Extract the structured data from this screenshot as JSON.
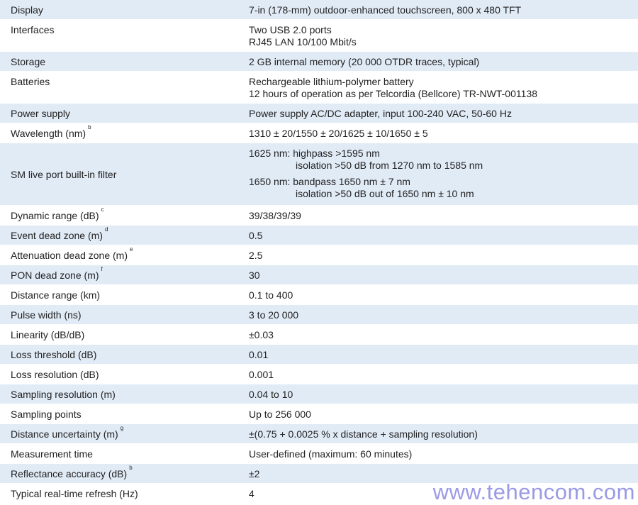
{
  "specs": [
    {
      "label": "Display",
      "sup": "",
      "lines": [
        "7-in (178-mm) outdoor-enhanced touchscreen, 800 x 480 TFT"
      ]
    },
    {
      "label": "Interfaces",
      "sup": "",
      "lines": [
        "Two USB 2.0 ports",
        "RJ45 LAN 10/100 Mbit/s"
      ]
    },
    {
      "label": "Storage",
      "sup": "",
      "lines": [
        "2 GB internal memory (20 000 OTDR traces, typical)"
      ]
    },
    {
      "label": "Batteries",
      "sup": "",
      "lines": [
        "Rechargeable lithium-polymer battery",
        "12 hours of operation as per Telcordia (Bellcore) TR-NWT-001138"
      ]
    },
    {
      "label": "Power supply",
      "sup": "",
      "lines": [
        "Power supply AC/DC adapter, input 100-240 VAC, 50-60 Hz"
      ]
    },
    {
      "label": "Wavelength (nm)",
      "sup": "b",
      "lines": [
        "1310 ± 20/1550 ± 20/1625 ± 10/1650 ± 5"
      ]
    },
    {
      "label": "SM live port built-in filter",
      "sup": "",
      "groups": [
        {
          "first": "1625 nm: highpass >1595 nm",
          "second": "isolation >50 dB from 1270 nm to 1585 nm"
        },
        {
          "first": "1650 nm: bandpass 1650 nm ± 7 nm",
          "second": "isolation >50 dB out of 1650 nm ± 10 nm"
        }
      ]
    },
    {
      "label": "Dynamic range (dB)",
      "sup": "c",
      "lines": [
        "39/38/39/39"
      ]
    },
    {
      "label": "Event dead zone (m)",
      "sup": "d",
      "lines": [
        "0.5"
      ]
    },
    {
      "label": "Attenuation dead zone (m)",
      "sup": "e",
      "lines": [
        "2.5"
      ]
    },
    {
      "label": "PON dead zone (m)",
      "sup": "f",
      "lines": [
        "30"
      ]
    },
    {
      "label": "Distance range (km)",
      "sup": "",
      "lines": [
        "0.1 to 400"
      ]
    },
    {
      "label": "Pulse width (ns)",
      "sup": "",
      "lines": [
        "3 to 20 000"
      ]
    },
    {
      "label": "Linearity (dB/dB)",
      "sup": "",
      "lines": [
        "±0.03"
      ]
    },
    {
      "label": "Loss threshold (dB)",
      "sup": "",
      "lines": [
        "0.01"
      ]
    },
    {
      "label": "Loss resolution (dB)",
      "sup": "",
      "lines": [
        "0.001"
      ]
    },
    {
      "label": "Sampling resolution (m)",
      "sup": "",
      "lines": [
        "0.04 to 10"
      ]
    },
    {
      "label": "Sampling points",
      "sup": "",
      "lines": [
        "Up to 256 000"
      ]
    },
    {
      "label": "Distance uncertainty (m)",
      "sup": "g",
      "lines": [
        "±(0.75 + 0.0025 % x distance + sampling resolution)"
      ]
    },
    {
      "label": "Measurement time",
      "sup": "",
      "lines": [
        "User-defined (maximum: 60 minutes)"
      ]
    },
    {
      "label": "Reflectance accuracy (dB)",
      "sup": "b",
      "lines": [
        "±2"
      ]
    },
    {
      "label": "Typical real-time refresh (Hz)",
      "sup": "",
      "lines": [
        "4"
      ]
    }
  ],
  "watermark": "www.tehencom.com",
  "colors": {
    "shaded_row": "#e1ebf6",
    "plain_row": "#ffffff",
    "watermark": "#9a9ae6"
  }
}
